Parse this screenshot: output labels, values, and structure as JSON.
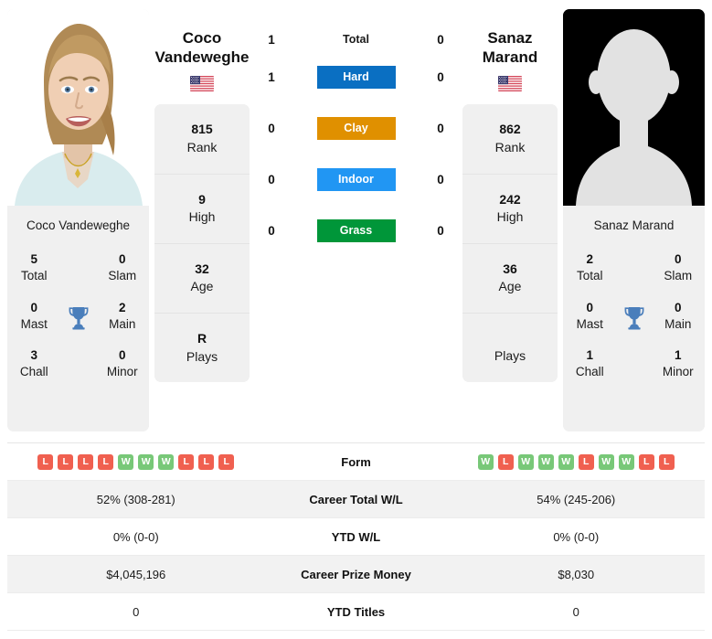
{
  "players": {
    "left": {
      "display_name": "Coco\nVandeweghe",
      "name_line1": "Coco",
      "name_line2": "Vandeweghe",
      "card_name": "Coco Vandeweghe",
      "country": "USA",
      "flag": "us-flag-icon",
      "photo": "player-photo",
      "stats": [
        {
          "value": "815",
          "label": "Rank"
        },
        {
          "value": "9",
          "label": "High"
        },
        {
          "value": "32",
          "label": "Age"
        },
        {
          "value": "R",
          "label": "Plays"
        }
      ],
      "titles": [
        {
          "value": "5",
          "label": "Total"
        },
        {
          "value": "0",
          "label": "Slam"
        },
        {
          "value": "0",
          "label": "Mast"
        },
        {
          "value": "2",
          "label": "Main"
        },
        {
          "value": "3",
          "label": "Chall"
        },
        {
          "value": "0",
          "label": "Minor"
        }
      ],
      "form": [
        "L",
        "L",
        "L",
        "L",
        "W",
        "W",
        "W",
        "L",
        "L",
        "L"
      ],
      "career_total_wl": "52% (308-281)",
      "ytd_wl": "0% (0-0)",
      "career_prize_money": "$4,045,196",
      "ytd_titles": "0"
    },
    "right": {
      "display_name": "Sanaz\nMarand",
      "name_line1": "Sanaz",
      "name_line2": "Marand",
      "card_name": "Sanaz Marand",
      "country": "USA",
      "flag": "us-flag-icon",
      "photo": "player-silhouette-placeholder",
      "stats": [
        {
          "value": "862",
          "label": "Rank"
        },
        {
          "value": "242",
          "label": "High"
        },
        {
          "value": "36",
          "label": "Age"
        },
        {
          "value": "",
          "label": "Plays"
        }
      ],
      "titles": [
        {
          "value": "2",
          "label": "Total"
        },
        {
          "value": "0",
          "label": "Slam"
        },
        {
          "value": "0",
          "label": "Mast"
        },
        {
          "value": "0",
          "label": "Main"
        },
        {
          "value": "1",
          "label": "Chall"
        },
        {
          "value": "1",
          "label": "Minor"
        }
      ],
      "form": [
        "W",
        "L",
        "W",
        "W",
        "W",
        "L",
        "W",
        "W",
        "L",
        "L"
      ],
      "career_total_wl": "54% (245-206)",
      "ytd_wl": "0% (0-0)",
      "career_prize_money": "$8,030",
      "ytd_titles": "0"
    }
  },
  "head_to_head": [
    {
      "label": "Total",
      "left": "1",
      "right": "0",
      "style": "plain",
      "color": ""
    },
    {
      "label": "Hard",
      "left": "1",
      "right": "0",
      "style": "badge",
      "color": "#0a6fc2"
    },
    {
      "label": "Clay",
      "left": "0",
      "right": "0",
      "style": "badge",
      "color": "#e09000"
    },
    {
      "label": "Indoor",
      "left": "0",
      "right": "0",
      "style": "badge",
      "color": "#2196f3"
    },
    {
      "label": "Grass",
      "left": "0",
      "right": "0",
      "style": "badge",
      "color": "#009639"
    }
  ],
  "stats_table": [
    {
      "label": "Form",
      "kind": "form",
      "left": "",
      "right": ""
    },
    {
      "label": "Career Total W/L",
      "kind": "text",
      "left": "52% (308-281)",
      "right": "54% (245-206)"
    },
    {
      "label": "YTD W/L",
      "kind": "text",
      "left": "0% (0-0)",
      "right": "0% (0-0)"
    },
    {
      "label": "Career Prize Money",
      "kind": "text",
      "left": "$4,045,196",
      "right": "$8,030"
    },
    {
      "label": "YTD Titles",
      "kind": "text",
      "left": "0",
      "right": "0"
    }
  ],
  "icons": {
    "trophy": "trophy-icon",
    "trophy_color": "#4a7ebb"
  },
  "colors": {
    "win": "#78c878",
    "loss": "#f06050",
    "panel": "#f0f0f0",
    "row_shaded": "#f2f2f2"
  }
}
